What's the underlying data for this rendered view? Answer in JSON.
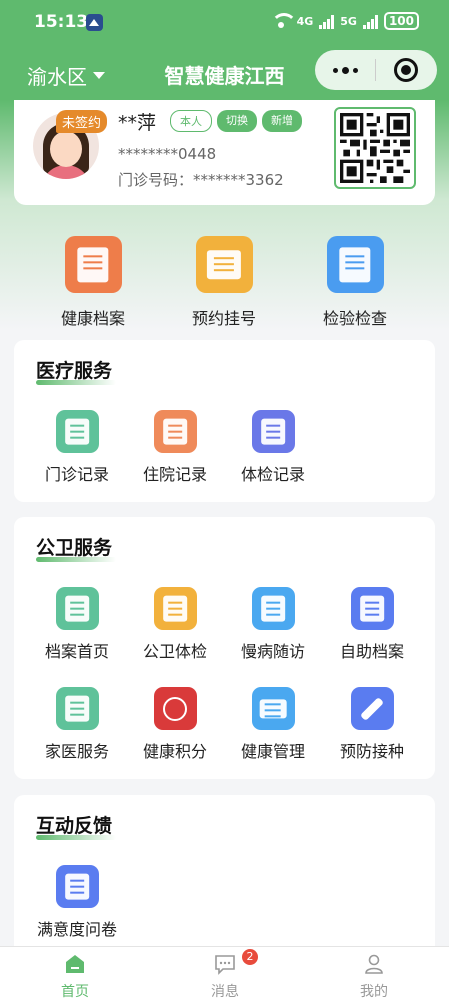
{
  "status_bar": {
    "time": "15:13",
    "network_1": "4G",
    "network_2": "5G",
    "battery": "100"
  },
  "nav": {
    "region": "渝水区",
    "title": "智慧健康江西"
  },
  "profile": {
    "badge": "未签约",
    "name": "**萍",
    "tags": [
      "本人",
      "切换",
      "新增"
    ],
    "id_number": "********0448",
    "clinic_number": "门诊号码：*******3362"
  },
  "quick_actions": [
    {
      "label": "健康档案",
      "icon": "health-record-icon",
      "color": "#ee7d4a"
    },
    {
      "label": "预约挂号",
      "icon": "appointment-icon",
      "color": "#f2b13c"
    },
    {
      "label": "检验检查",
      "icon": "lab-test-icon",
      "color": "#4a9cf0"
    }
  ],
  "medical_services": {
    "title": "医疗服务",
    "items": [
      {
        "label": "门诊记录",
        "icon": "outpatient-record-icon",
        "color": "#5fc29a"
      },
      {
        "label": "住院记录",
        "icon": "hospital-bed-icon",
        "color": "#ef8a5a"
      },
      {
        "label": "体检记录",
        "icon": "medical-kit-icon",
        "color": "#6a78e8"
      }
    ]
  },
  "public_health": {
    "title": "公卫服务",
    "items": [
      {
        "label": "档案首页",
        "icon": "file-home-icon",
        "color": "#5fc29a"
      },
      {
        "label": "公卫体检",
        "icon": "checkup-search-icon",
        "color": "#f2b13c"
      },
      {
        "label": "慢病随访",
        "icon": "heartbeat-icon",
        "color": "#4aa8f0"
      },
      {
        "label": "自助档案",
        "icon": "clipboard-icon",
        "color": "#5a7cf0"
      },
      {
        "label": "家医服务",
        "icon": "doctor-icon",
        "color": "#5fc29a"
      },
      {
        "label": "健康积分",
        "icon": "points-icon",
        "color": "#d93a3a"
      },
      {
        "label": "健康管理",
        "icon": "health-monitor-icon",
        "color": "#4aa8f0"
      },
      {
        "label": "预防接种",
        "icon": "vaccine-icon",
        "color": "#5a7cf0"
      }
    ]
  },
  "feedback": {
    "title": "互动反馈",
    "items": [
      {
        "label": "满意度问卷",
        "icon": "survey-icon",
        "color": "#5a7cf0"
      }
    ]
  },
  "tab_bar": {
    "items": [
      {
        "label": "首页",
        "icon": "home-icon",
        "active": true
      },
      {
        "label": "消息",
        "icon": "message-icon",
        "badge": "2"
      },
      {
        "label": "我的",
        "icon": "profile-icon"
      }
    ],
    "active_color": "#5fba6e",
    "inactive_color": "#999999"
  }
}
